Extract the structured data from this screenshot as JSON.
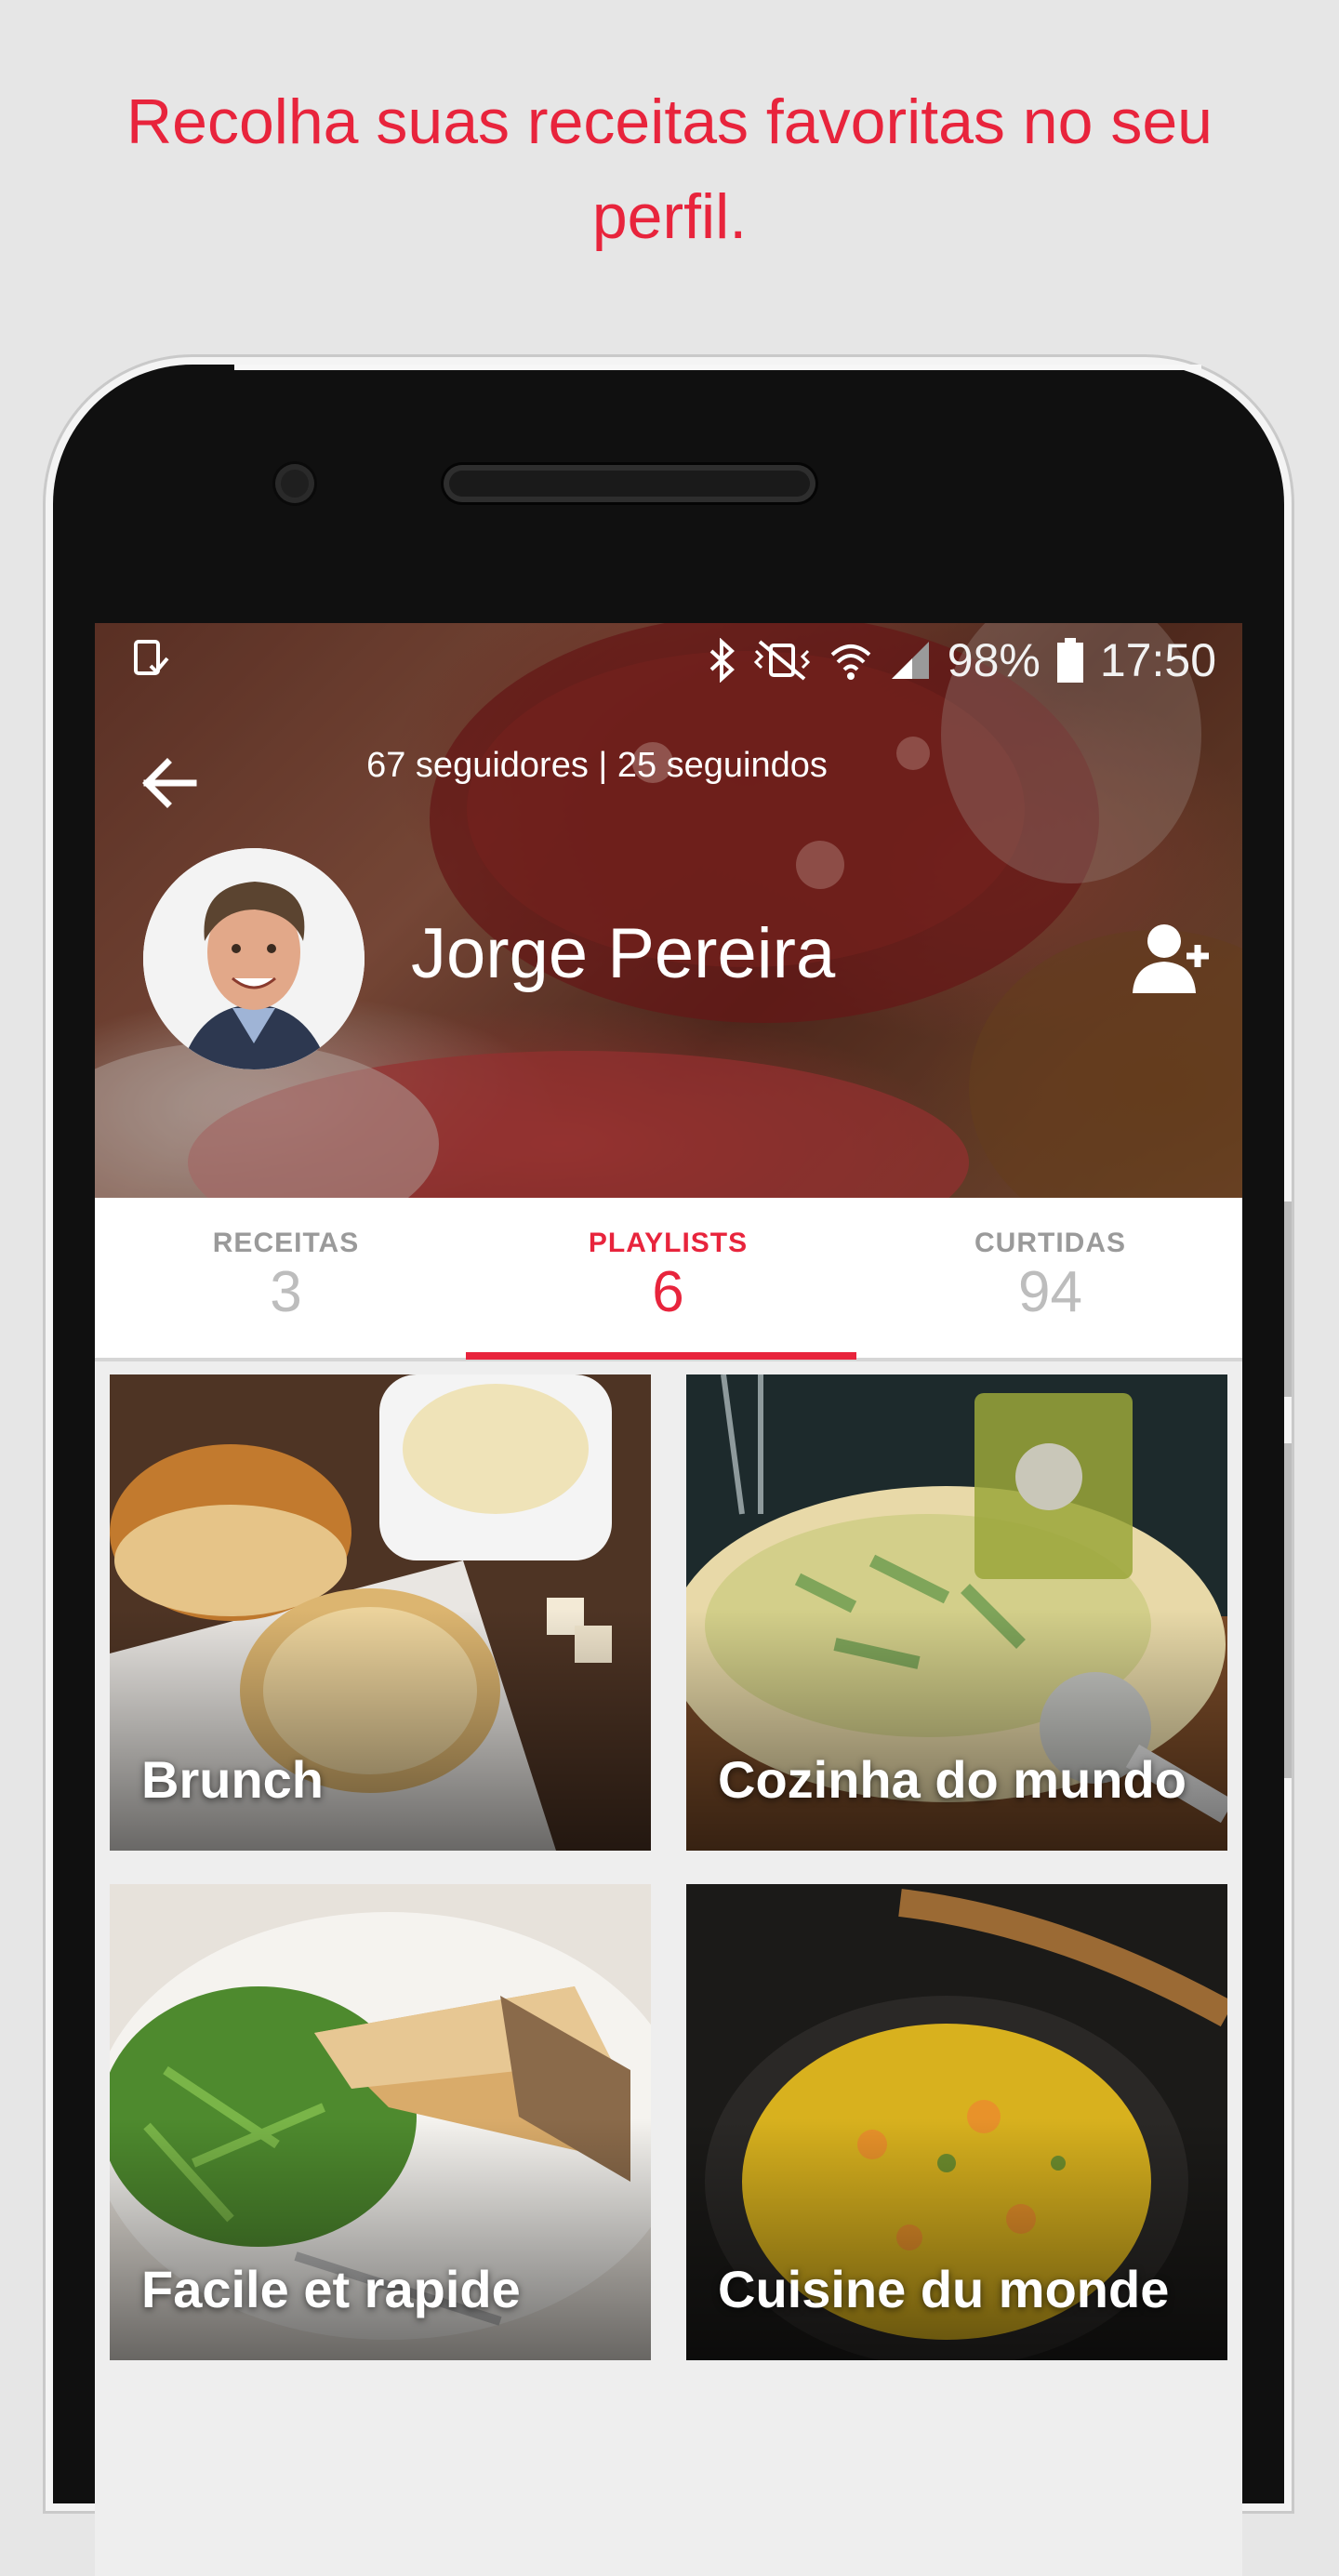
{
  "headline": "Recolha suas receitas favoritas no seu perfil.",
  "status_bar": {
    "battery": "98%",
    "time": "17:50",
    "icons": [
      "device-check-icon",
      "bluetooth-icon",
      "vibrate-mute-icon",
      "wifi-icon",
      "signal-icon",
      "battery-icon"
    ]
  },
  "profile": {
    "followers_text": "67 seguidores | 25 seguindos",
    "name": "Jorge Pereira"
  },
  "tabs": [
    {
      "label": "RECEITAS",
      "count": "3"
    },
    {
      "label": "PLAYLISTS",
      "count": "6"
    },
    {
      "label": "CURTIDAS",
      "count": "94"
    }
  ],
  "active_tab": "PLAYLISTS",
  "playlists": [
    {
      "title": "Brunch"
    },
    {
      "title": "Cozinha do mundo"
    },
    {
      "title": "Facile et rapide"
    },
    {
      "title": "Cuisine du monde"
    }
  ],
  "colors": {
    "accent": "#e8243c",
    "background": "#e6e6e6",
    "tab_inactive": "#9a9a9a"
  }
}
